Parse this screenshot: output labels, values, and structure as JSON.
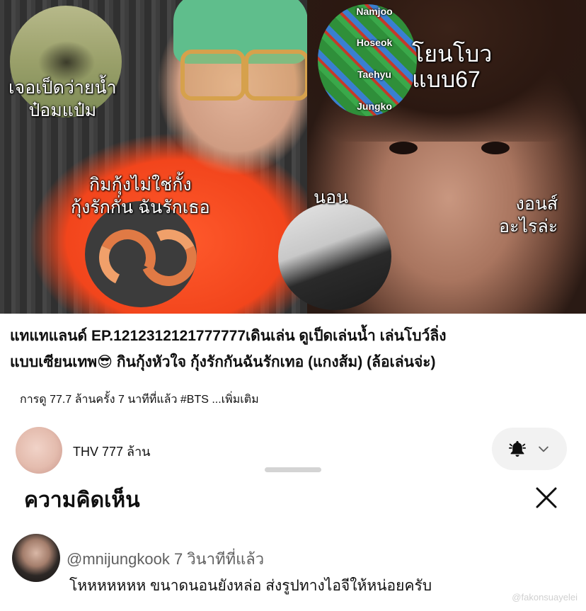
{
  "thumbnail": {
    "overlays": {
      "duck": "เจอเป็ดว่ายน้ำ\nป๋อมแป๋ม",
      "bowling": "โยนโบว\nแบบ67",
      "shrimp": "กิมกุ้งไม่ใช่กั้ง\nกุ้งรักกั่น ฉันรักเธอ",
      "sleep": "นอน",
      "sulk": "งอนส์\nอะไรล่ะ"
    },
    "bowling_names": [
      "Namjoo",
      "Hoseok",
      "Taehyu",
      "Jungko"
    ]
  },
  "video": {
    "title_line1": "แทแทแลนด์ EP.1212312121777777เดินเล่น ดูเป็ดเล่นน้ำ เล่นโบว์ลิ่ง",
    "title_line2": "แบบเซียนเทพ😎 กินกุ้งหัวใจ กุ้งรักกันฉันรักเทอ (แกงส้ม) (ล้อเล่นจ่ะ)",
    "meta": "การดู 77.7 ล้านครั้ง 7 นาทีที่แล้ว #BTS ...เพิ่มเติม"
  },
  "channel": {
    "name": "THV 777 ล้าน",
    "bell_icon": "bell-icon",
    "chevron_icon": "chevron-down-icon"
  },
  "comments_panel": {
    "title": "ความคิดเห็น",
    "close_icon": "close-icon",
    "comment": {
      "username": "@mnijungkook",
      "time": "7 วินาทีที่แล้ว",
      "text": "โหหหหหหห ขนาดนอนยังหล่อ ส่งรูปทางไอจีให้หน่อยครับ"
    }
  },
  "watermark": "@fakonsuayelei"
}
